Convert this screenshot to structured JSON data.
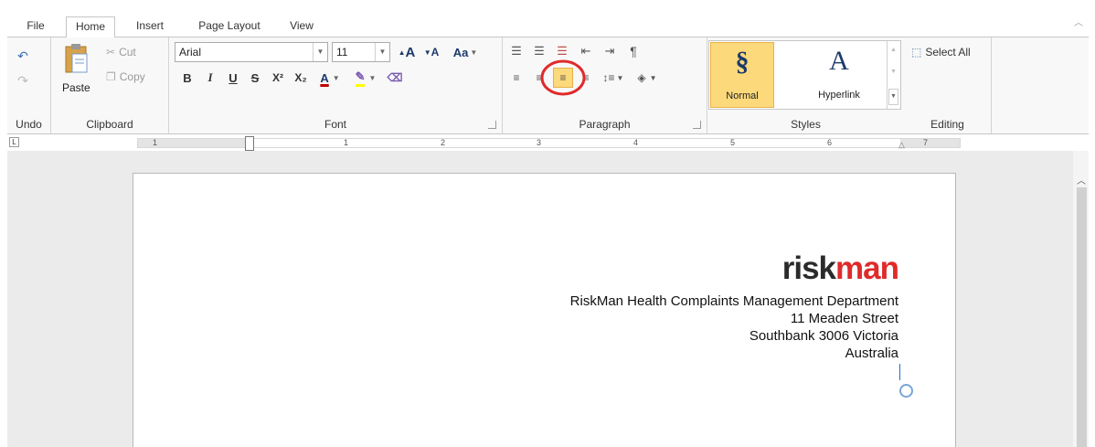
{
  "tabs": [
    "File",
    "Home",
    "Insert",
    "Page Layout",
    "View"
  ],
  "active_tab": "Home",
  "undo": {
    "group_label": "Undo"
  },
  "clipboard": {
    "paste_label": "Paste",
    "cut_label": "Cut",
    "copy_label": "Copy",
    "group_label": "Clipboard"
  },
  "font": {
    "family": "Arial",
    "size": "11",
    "group_label": "Font",
    "bold": "B",
    "italic": "I",
    "underline": "U",
    "strike": "S",
    "superscript": "X²",
    "subscript": "X₂",
    "font_color": "A",
    "grow": "A",
    "shrink": "A",
    "change_case": "Aa",
    "font_color_hex": "#c00000",
    "highlight_hex": "#ffff00"
  },
  "paragraph": {
    "group_label": "Paragraph",
    "active": "align-right",
    "highlight_hex": "#e02a2a"
  },
  "styles": {
    "group_label": "Styles",
    "items": [
      "Normal",
      "Hyperlink"
    ],
    "normal_glyph": "§",
    "hyperlink_glyph": "A",
    "selected_hex": "#fcd97a"
  },
  "editing": {
    "select_all_label": "Select All",
    "group_label": "Editing"
  },
  "ruler": {
    "labels": [
      "1",
      "1",
      "2",
      "3",
      "4",
      "5",
      "6",
      "7"
    ]
  },
  "document": {
    "logo_risk": "risk",
    "logo_man": "man",
    "address": [
      "RiskMan Health Complaints Management Department",
      "11 Meaden Street",
      "Southbank 3006 Victoria",
      "Australia"
    ]
  }
}
